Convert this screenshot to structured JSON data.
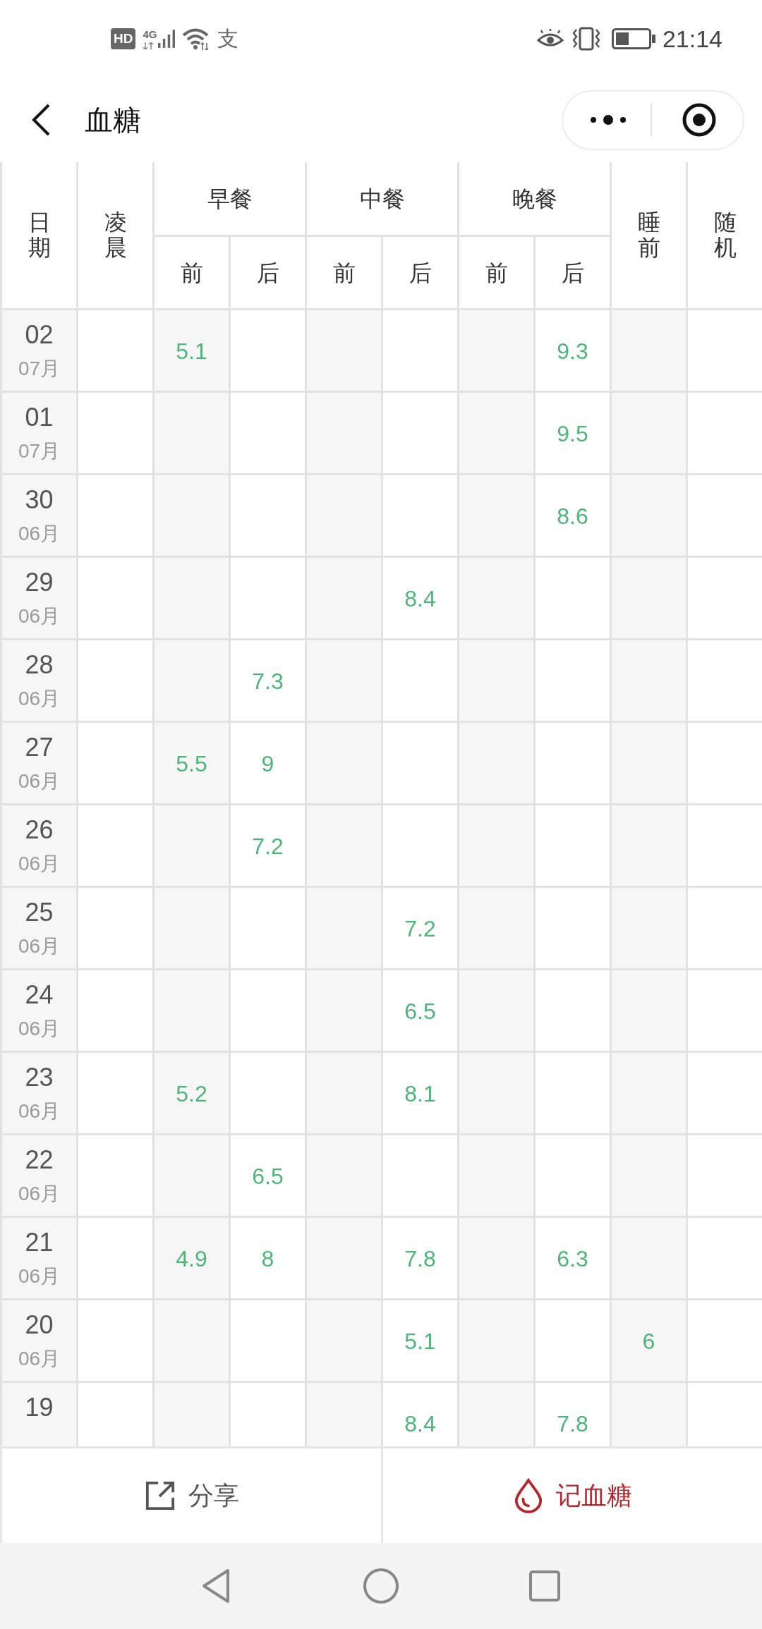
{
  "status_bar": {
    "badge": "HD",
    "network": "4G",
    "app_glyph": "支",
    "time": "21:14"
  },
  "header": {
    "title": "血糖"
  },
  "table": {
    "columns": [
      {
        "label": "日期",
        "grouped": false
      },
      {
        "label": "凌晨",
        "grouped": false
      },
      {
        "label": "前",
        "grouped": true,
        "group": {
          "label": "早餐"
        }
      },
      {
        "label": "后",
        "grouped": true
      },
      {
        "label": "前",
        "grouped": true,
        "group": {
          "label": "中餐"
        }
      },
      {
        "label": "后",
        "grouped": true
      },
      {
        "label": "前",
        "grouped": true,
        "group": {
          "label": "晚餐"
        }
      },
      {
        "label": "后",
        "grouped": true
      },
      {
        "label": "睡前",
        "grouped": false
      },
      {
        "label": "随机",
        "grouped": false
      }
    ],
    "rows": [
      {
        "cells": [
          {
            "day": "02",
            "month": "07月"
          },
          null,
          "5.1",
          null,
          null,
          null,
          null,
          "9.3",
          null,
          null
        ]
      },
      {
        "cells": [
          {
            "day": "01",
            "month": "07月"
          },
          null,
          null,
          null,
          null,
          null,
          null,
          "9.5",
          null,
          null
        ]
      },
      {
        "cells": [
          {
            "day": "30",
            "month": "06月"
          },
          null,
          null,
          null,
          null,
          null,
          null,
          "8.6",
          null,
          null
        ]
      },
      {
        "cells": [
          {
            "day": "29",
            "month": "06月"
          },
          null,
          null,
          null,
          null,
          "8.4",
          null,
          null,
          null,
          null
        ]
      },
      {
        "cells": [
          {
            "day": "28",
            "month": "06月"
          },
          null,
          null,
          "7.3",
          null,
          null,
          null,
          null,
          null,
          null
        ]
      },
      {
        "cells": [
          {
            "day": "27",
            "month": "06月"
          },
          null,
          "5.5",
          "9",
          null,
          null,
          null,
          null,
          null,
          null
        ]
      },
      {
        "cells": [
          {
            "day": "26",
            "month": "06月"
          },
          null,
          null,
          "7.2",
          null,
          null,
          null,
          null,
          null,
          null
        ]
      },
      {
        "cells": [
          {
            "day": "25",
            "month": "06月"
          },
          null,
          null,
          null,
          null,
          "7.2",
          null,
          null,
          null,
          null
        ]
      },
      {
        "cells": [
          {
            "day": "24",
            "month": "06月"
          },
          null,
          null,
          null,
          null,
          "6.5",
          null,
          null,
          null,
          null
        ]
      },
      {
        "cells": [
          {
            "day": "23",
            "month": "06月"
          },
          null,
          "5.2",
          null,
          null,
          "8.1",
          null,
          null,
          null,
          null
        ]
      },
      {
        "cells": [
          {
            "day": "22",
            "month": "06月"
          },
          null,
          null,
          "6.5",
          null,
          null,
          null,
          null,
          null,
          null
        ]
      },
      {
        "cells": [
          {
            "day": "21",
            "month": "06月"
          },
          null,
          "4.9",
          "8",
          null,
          "7.8",
          null,
          "6.3",
          null,
          null
        ]
      },
      {
        "cells": [
          {
            "day": "20",
            "month": "06月"
          },
          null,
          null,
          null,
          null,
          "5.1",
          null,
          null,
          "6",
          null
        ]
      },
      {
        "cells": [
          {
            "day": "19"
          },
          null,
          null,
          null,
          null,
          "8.4",
          null,
          "7.8",
          null,
          null
        ]
      }
    ]
  },
  "actions": [
    {
      "kind": "share",
      "label": "分享"
    },
    {
      "kind": "record",
      "label": "记血糖"
    }
  ]
}
